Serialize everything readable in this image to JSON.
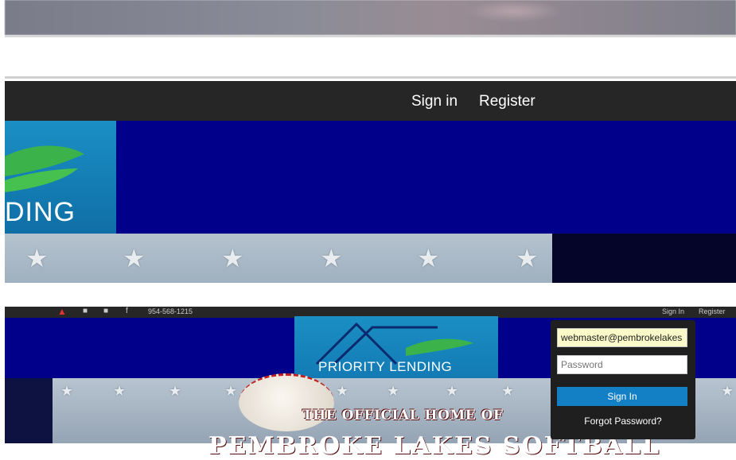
{
  "zoom_nav": {
    "sign_in": "Sign in",
    "register": "Register"
  },
  "zoom_logo": {
    "text": "DING"
  },
  "low_nav": {
    "phone": "954-568-1215",
    "sign_in": "Sign In",
    "register": "Register"
  },
  "low_logo": {
    "text": "PRIORITY LENDING"
  },
  "hero": {
    "headline": "THE OFFICIAL HOME OF",
    "headline2": "PEMBROKE LAKES SOFTBALL"
  },
  "login": {
    "email_value": "webmaster@pembrokelakes",
    "password_placeholder": "Password",
    "sign_in_button": "Sign In",
    "forgot_link": "Forgot Password?"
  },
  "colors": {
    "nav": "#262626",
    "hero_blue": "#00008a",
    "logo_blue": "#1a8fc4",
    "logo_green": "#3cb34a",
    "signin_blue": "#1380c6"
  }
}
